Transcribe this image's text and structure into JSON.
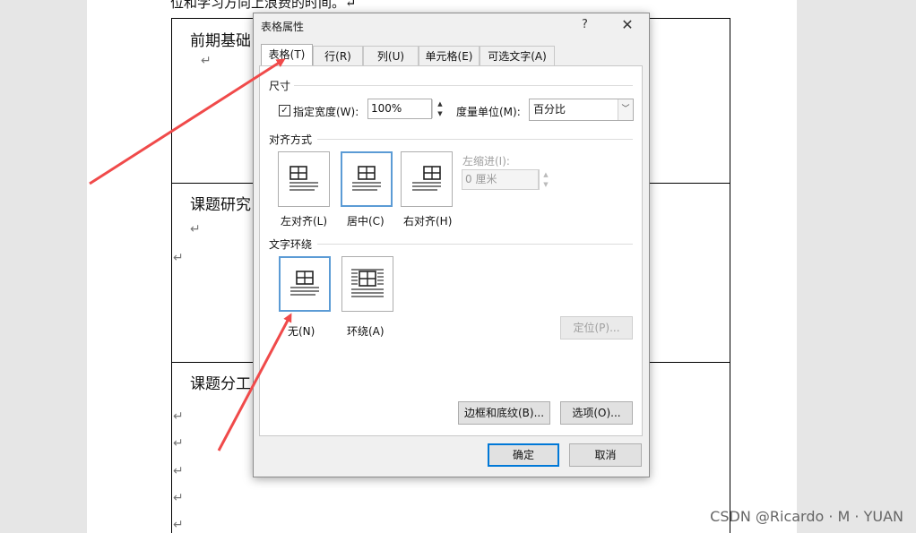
{
  "document": {
    "top_text": "位和学习方向上浪费的时间。↵",
    "sections": [
      {
        "title": "前期基础",
        "marks": [
          "↵"
        ]
      },
      {
        "title": "课题研究",
        "marks": [
          "↵",
          "↵"
        ]
      },
      {
        "title": "课题分工",
        "marks": [
          "↵",
          "↵",
          "↵",
          "↵",
          "↵"
        ]
      }
    ]
  },
  "dialog": {
    "title": "表格属性",
    "help": "?",
    "close": "✕",
    "tabs": [
      "表格(T)",
      "行(R)",
      "列(U)",
      "单元格(E)",
      "可选文字(A)"
    ],
    "active_tab": 0,
    "size": {
      "group_label": "尺寸",
      "checkbox_mark": "✓",
      "preferred_width_label": "指定宽度(W):",
      "preferred_width_value": "100%",
      "measure_in_label": "度量单位(M):",
      "measure_in_value": "百分比"
    },
    "alignment": {
      "group_label": "对齐方式",
      "options": [
        "左对齐(L)",
        "居中(C)",
        "右对齐(H)"
      ],
      "selected": 1,
      "indent_label": "左缩进(I):",
      "indent_value": "0 厘米"
    },
    "wrapping": {
      "group_label": "文字环绕",
      "options": [
        "无(N)",
        "环绕(A)"
      ],
      "selected": 0,
      "positioning_button": "定位(P)..."
    },
    "borders_button": "边框和底纹(B)...",
    "options_button": "选项(O)...",
    "ok_button": "确定",
    "cancel_button": "取消"
  },
  "watermark": "CSDN @Ricardo · M · YUAN",
  "colors": {
    "arrow": "#f04a4a",
    "selection": "#5b9bd5",
    "dialog_bg": "#f0f0f0"
  }
}
